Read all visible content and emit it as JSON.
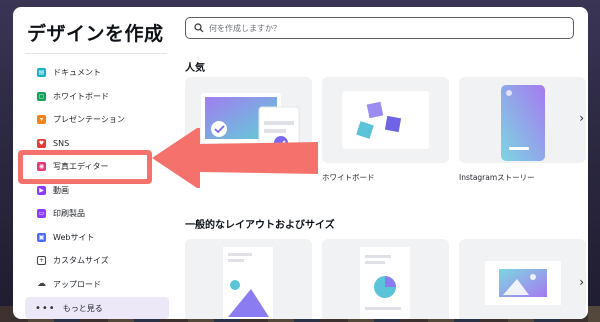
{
  "modal": {
    "title": "デザインを作成",
    "search_placeholder": "何を作成しますか？"
  },
  "sidebar": {
    "items": [
      {
        "label": "ドキュメント",
        "icon": "document-icon",
        "color": "#1ab0c5"
      },
      {
        "label": "ホワイトボード",
        "icon": "whiteboard-icon",
        "color": "#13a15a"
      },
      {
        "label": "プレゼンテーション",
        "icon": "presentation-icon",
        "color": "#f58220"
      },
      {
        "label": "SNS",
        "icon": "social-media-icon",
        "color": "#e53935"
      },
      {
        "label": "写真エディター",
        "icon": "photo-editor-icon",
        "color": "#e8397a"
      },
      {
        "label": "動画",
        "icon": "video-icon",
        "color": "#8b3dff"
      },
      {
        "label": "印刷製品",
        "icon": "print-icon",
        "color": "#8b3dff"
      },
      {
        "label": "Webサイト",
        "icon": "website-icon",
        "color": "#4a6cf7"
      },
      {
        "label": "カスタムサイズ",
        "icon": "custom-size-icon",
        "color": "#444444"
      },
      {
        "label": "アップロード",
        "icon": "upload-icon",
        "color": "#444444"
      }
    ],
    "more_label": "もっと見る"
  },
  "sections": {
    "popular_title": "人気",
    "popular_cards": [
      {
        "label": ""
      },
      {
        "label": "ホワイトボード"
      },
      {
        "label": "Instagramストーリー"
      }
    ],
    "layouts_title": "一般的なレイアウトおよびサイズ"
  },
  "colors": {
    "accent": "#8b3dff",
    "highlight": "#f4726b",
    "more_bg": "#ede8f8"
  }
}
